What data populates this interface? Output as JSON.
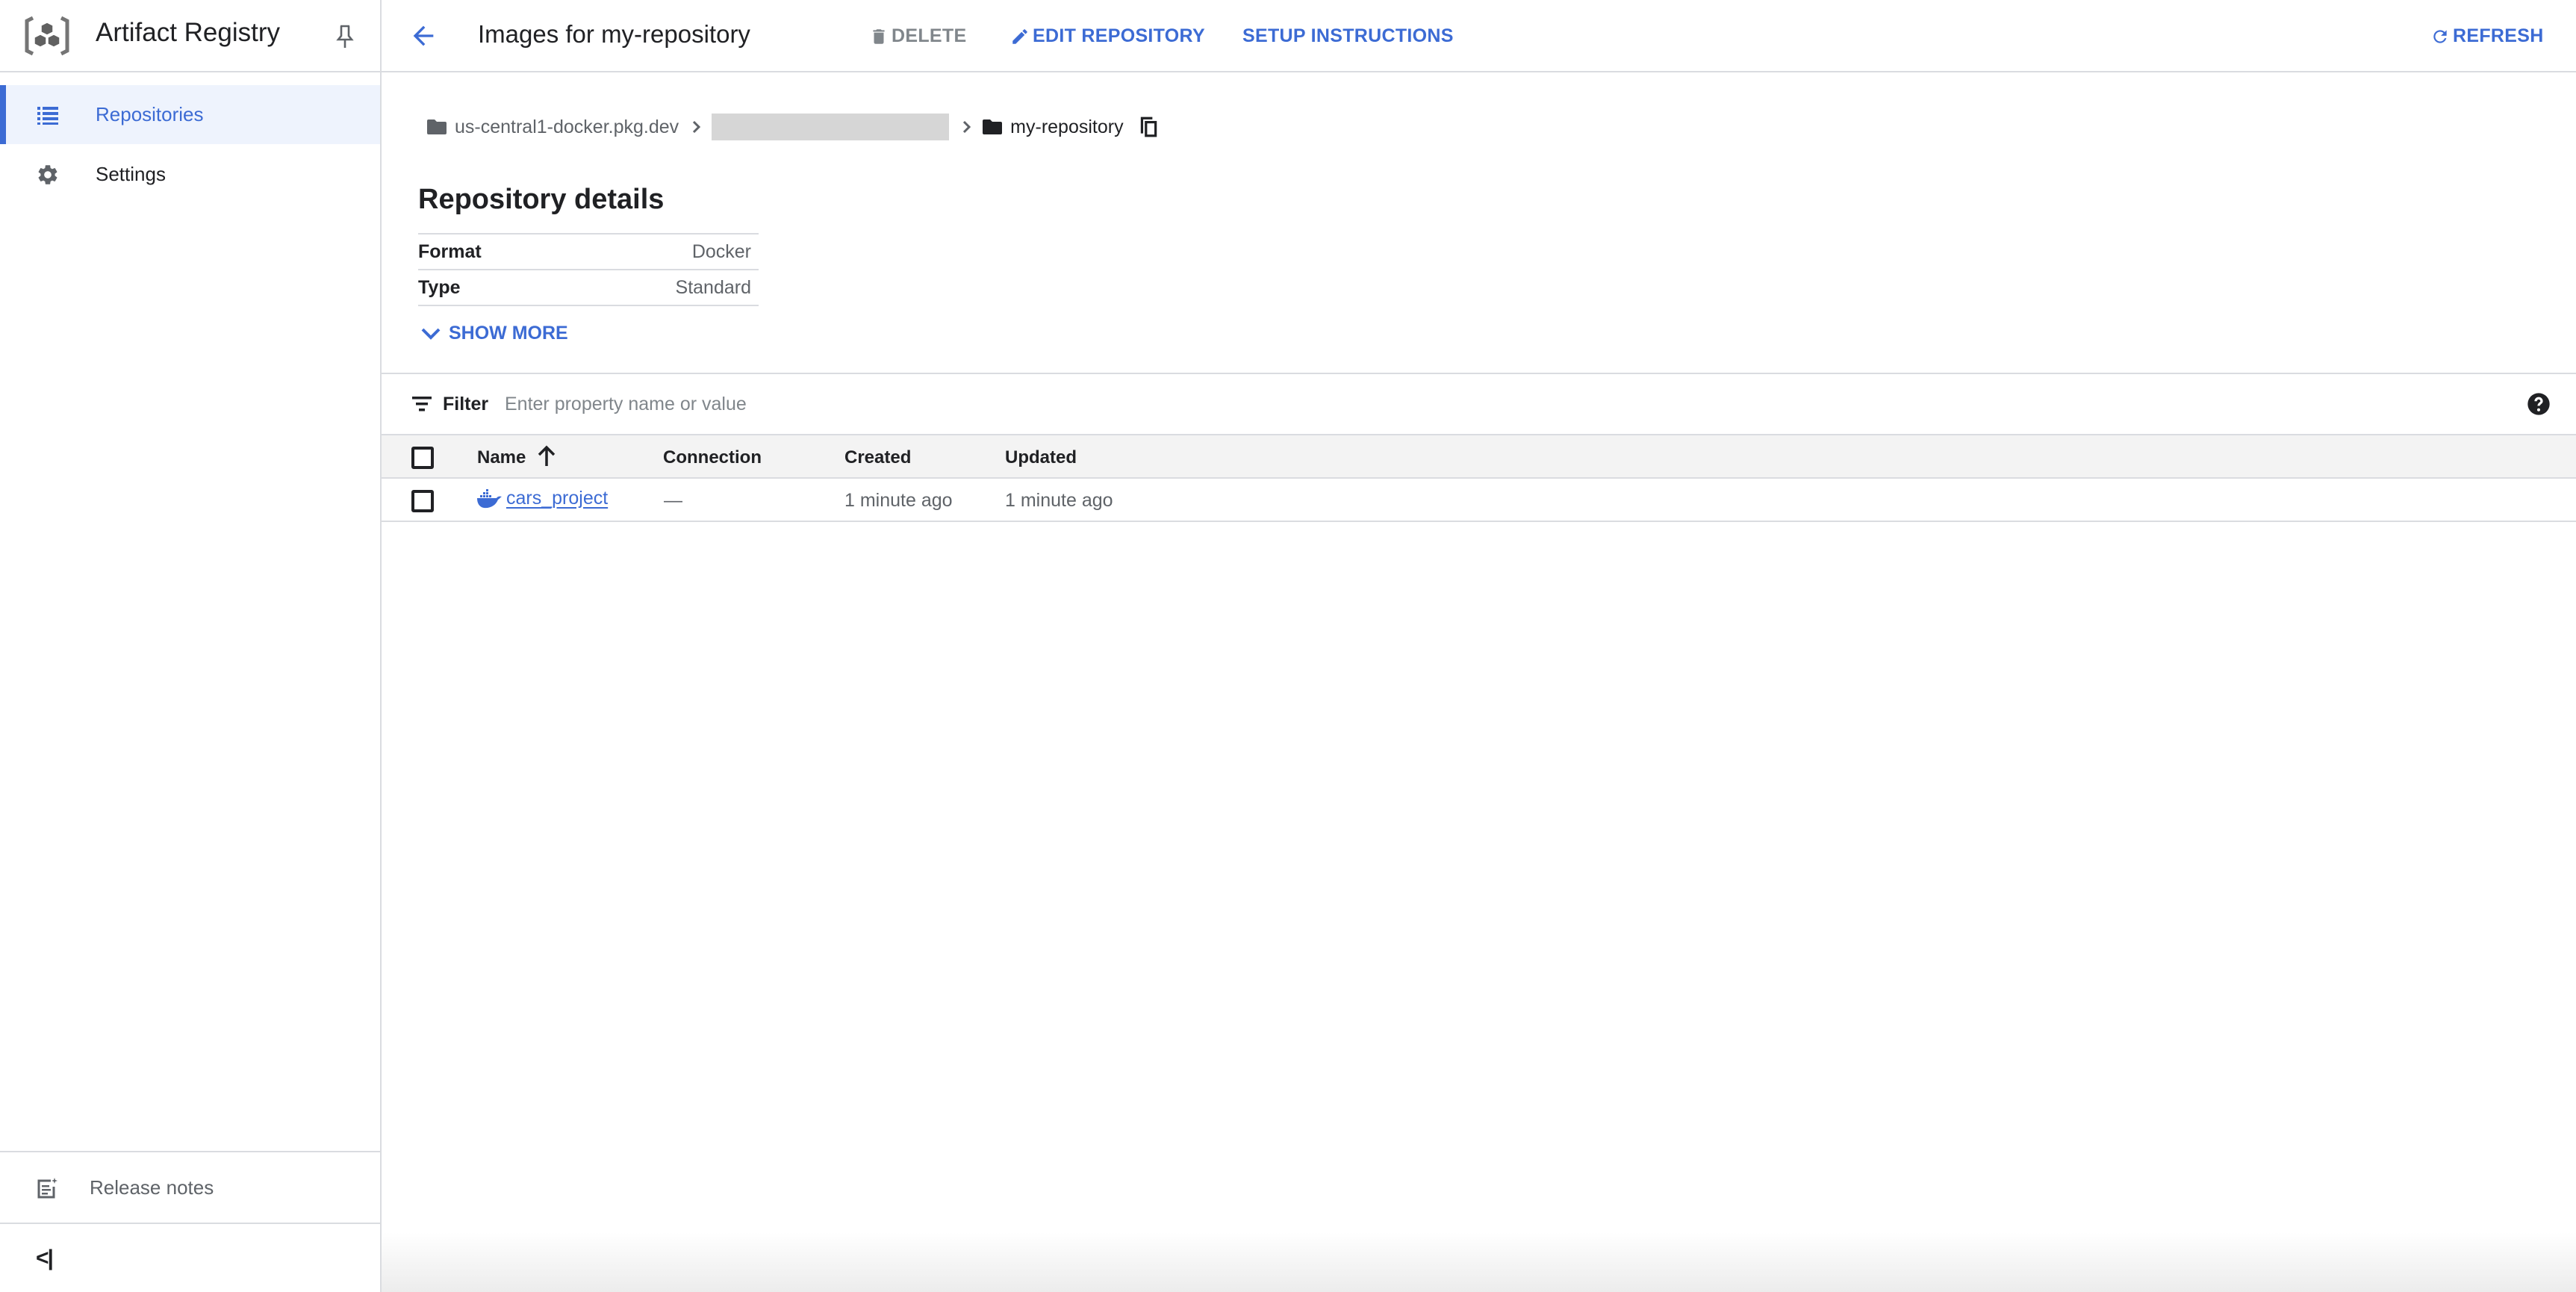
{
  "app": {
    "title": "Artifact Registry"
  },
  "sidebar": {
    "items": [
      {
        "label": "Repositories",
        "icon": "list-icon",
        "active": true
      },
      {
        "label": "Settings",
        "icon": "gear-icon",
        "active": false
      }
    ],
    "release_notes": {
      "label": "Release notes",
      "icon": "release-notes-icon"
    },
    "collapse_glyph": "<|"
  },
  "header": {
    "title": "Images for my-repository",
    "actions": {
      "delete": "DELETE",
      "edit": "EDIT REPOSITORY",
      "setup": "SETUP INSTRUCTIONS",
      "refresh": "REFRESH"
    }
  },
  "breadcrumb": {
    "host": "us-central1-docker.pkg.dev",
    "project": "",
    "repository": "my-repository"
  },
  "details": {
    "title": "Repository details",
    "rows": [
      {
        "key": "Format",
        "value": "Docker"
      },
      {
        "key": "Type",
        "value": "Standard"
      }
    ],
    "show_more": "SHOW MORE"
  },
  "filter": {
    "label": "Filter",
    "placeholder": "Enter property name or value",
    "value": ""
  },
  "table": {
    "columns": [
      "Name",
      "Connection",
      "Created",
      "Updated"
    ],
    "sort": {
      "column": "Name",
      "direction": "ascending"
    },
    "rows": [
      {
        "name": "cars_project",
        "connection": "—",
        "created": "1 minute ago",
        "updated": "1 minute ago",
        "icon": "docker-icon"
      }
    ]
  },
  "colors": {
    "accent": "#3c6bd4",
    "active_bg": "#eef3fd",
    "border": "#dadce0",
    "header_row_bg": "#f3f3f3"
  }
}
